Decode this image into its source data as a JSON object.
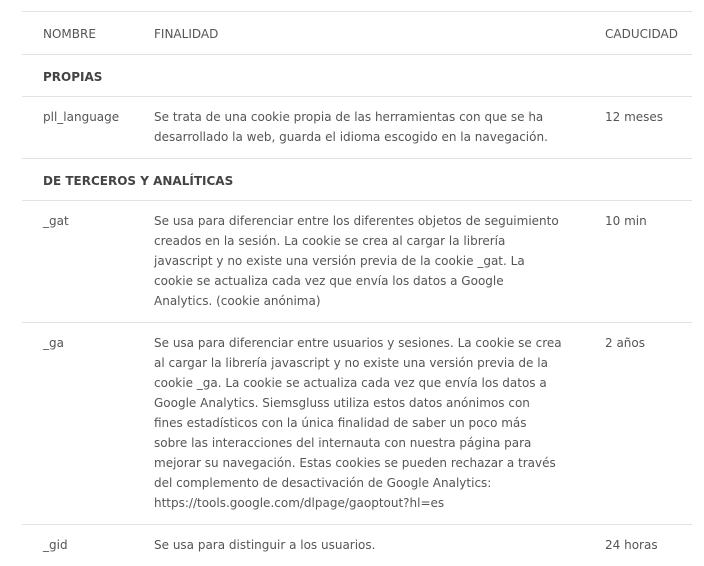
{
  "headers": {
    "nombre": "NOMBRE",
    "finalidad": "FINALIDAD",
    "caducidad": "CADUCIDAD"
  },
  "sections": [
    {
      "title": "PROPIAS",
      "rows": [
        {
          "name": "pll_language",
          "finalidad": "Se trata de una cookie propia de las herramientas con que se ha desarrollado la web, guarda el idioma escogido en la navegación.",
          "caducidad": "12 meses"
        }
      ]
    },
    {
      "title": "DE TERCEROS Y ANALÍTICAS",
      "rows": [
        {
          "name": "_gat",
          "finalidad": "Se usa para diferenciar entre los diferentes objetos de seguimiento creados en la sesión. La cookie se crea al cargar la librería javascript y no existe una versión previa de la cookie _gat. La cookie se actualiza cada vez que envía los datos a Google Analytics. (cookie anónima)",
          "caducidad": "10 min"
        },
        {
          "name": "_ga",
          "finalidad": "Se usa para diferenciar entre usuarios y sesiones. La cookie se crea al cargar la librería javascript y no existe una versión previa de la cookie _ga. La cookie se actualiza cada vez que envía los datos a Google Analytics. Siemsgluss utiliza estos datos anónimos con fines estadísticos con la única finalidad de saber un poco más sobre las interacciones del internauta con nuestra página para mejorar su navegación. Estas cookies se pueden rechazar a través del complemento de desactivación de Google Analytics: https://tools.google.com/dlpage/gaoptout?hl=es",
          "caducidad": "2 años"
        },
        {
          "name": "_gid",
          "finalidad": "Se usa para distinguir a los usuarios.",
          "caducidad": "24 horas"
        }
      ]
    }
  ]
}
